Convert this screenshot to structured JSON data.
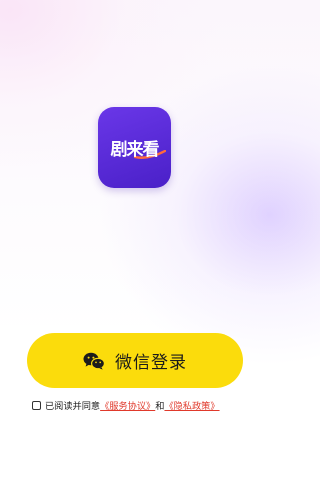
{
  "app": {
    "icon_text": "剧来看",
    "icon_bg_color": "#5a2ad8"
  },
  "login": {
    "button_label": "微信登录",
    "button_color": "#fbdc0c",
    "icon": "wechat-icon"
  },
  "agreement": {
    "checked": false,
    "prefix": "已阅读并同意",
    "service_link": "《服务协议》",
    "conjunction": "和",
    "privacy_link": "《隐私政策》",
    "link_color": "#e0392b"
  }
}
